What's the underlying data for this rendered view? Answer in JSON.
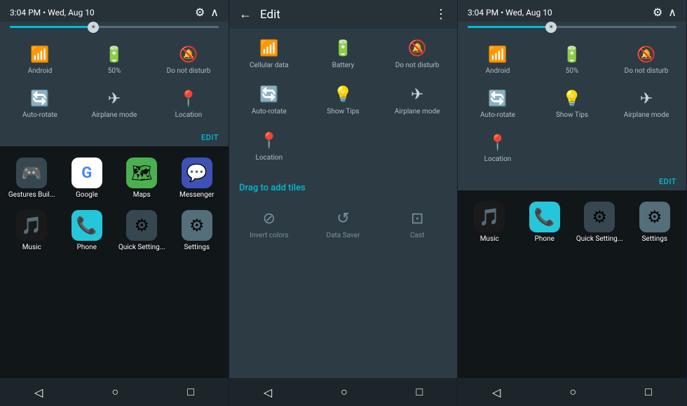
{
  "panel1": {
    "header": {
      "time_date": "3:04 PM  •  Wed, Aug 10"
    },
    "tiles": [
      {
        "id": "android",
        "icon": "📶",
        "label": "Android"
      },
      {
        "id": "battery",
        "icon": "🔋",
        "label": "50%"
      },
      {
        "id": "dnd",
        "icon": "🔕",
        "label": "Do not disturb"
      },
      {
        "id": "autorotate",
        "icon": "🔄",
        "label": "Auto-rotate"
      },
      {
        "id": "airplane",
        "icon": "✈",
        "label": "Airplane mode"
      },
      {
        "id": "location",
        "icon": "📍",
        "label": "Location"
      }
    ],
    "edit_label": "EDIT",
    "apps": [
      {
        "label": "Gestures Buil...",
        "color": "#37474f",
        "icon": "🎮"
      },
      {
        "label": "Google",
        "color": "#ffffff",
        "icon": "G"
      },
      {
        "label": "Maps",
        "color": "#4caf50",
        "icon": "🗺"
      },
      {
        "label": "Messenger",
        "color": "#3f51b5",
        "icon": "💬"
      },
      {
        "label": "Music",
        "color": "#1a1a1a",
        "icon": "🎵"
      },
      {
        "label": "Phone",
        "color": "#26c6da",
        "icon": "📞"
      },
      {
        "label": "Quick Setting...",
        "color": "#37474f",
        "icon": "⚙"
      },
      {
        "label": "Settings",
        "color": "#546e7a",
        "icon": "⚙"
      }
    ],
    "nav": [
      "◁",
      "○",
      "□"
    ]
  },
  "panel2": {
    "header": {
      "title": "Edit"
    },
    "current_tiles": [
      {
        "id": "cellular",
        "icon": "📶",
        "label": "Cellular data"
      },
      {
        "id": "battery",
        "icon": "🔋",
        "label": "Battery"
      },
      {
        "id": "dnd",
        "icon": "🔕",
        "label": "Do not disturb"
      },
      {
        "id": "autorotate",
        "icon": "🔄",
        "label": "Auto-rotate"
      },
      {
        "id": "showtips",
        "icon": "💡",
        "label": "Show Tips"
      },
      {
        "id": "airplane",
        "icon": "✈",
        "label": "Airplane mode"
      },
      {
        "id": "location",
        "icon": "📍",
        "label": "Location"
      }
    ],
    "drag_label": "Drag to add tiles",
    "add_tiles": [
      {
        "id": "invert",
        "icon": "⊘",
        "label": "Invert colors"
      },
      {
        "id": "datasaver",
        "icon": "↺",
        "label": "Data Saver"
      },
      {
        "id": "cast",
        "icon": "⊡",
        "label": "Cast"
      }
    ],
    "nav": [
      "◁",
      "○",
      "□"
    ]
  },
  "panel3": {
    "header": {
      "time_date": "3:04 PM  •  Wed, Aug 10"
    },
    "tiles": [
      {
        "id": "android",
        "icon": "📶",
        "label": "Android"
      },
      {
        "id": "battery",
        "icon": "🔋",
        "label": "50%"
      },
      {
        "id": "dnd",
        "icon": "🔕",
        "label": "Do not disturb"
      },
      {
        "id": "autorotate",
        "icon": "🔄",
        "label": "Auto-rotate"
      },
      {
        "id": "showtips",
        "icon": "💡",
        "label": "Show Tips"
      },
      {
        "id": "airplane",
        "icon": "✈",
        "label": "Airplane mode"
      },
      {
        "id": "location",
        "icon": "📍",
        "label": "Location"
      }
    ],
    "edit_label": "EDIT",
    "apps": [
      {
        "label": "Music",
        "color": "#1a1a1a",
        "icon": "🎵"
      },
      {
        "label": "Phone",
        "color": "#26c6da",
        "icon": "📞"
      },
      {
        "label": "Quick Setting...",
        "color": "#37474f",
        "icon": "⚙"
      },
      {
        "label": "Settings",
        "color": "#546e7a",
        "icon": "⚙"
      }
    ],
    "nav": [
      "◁",
      "○",
      "□"
    ]
  }
}
